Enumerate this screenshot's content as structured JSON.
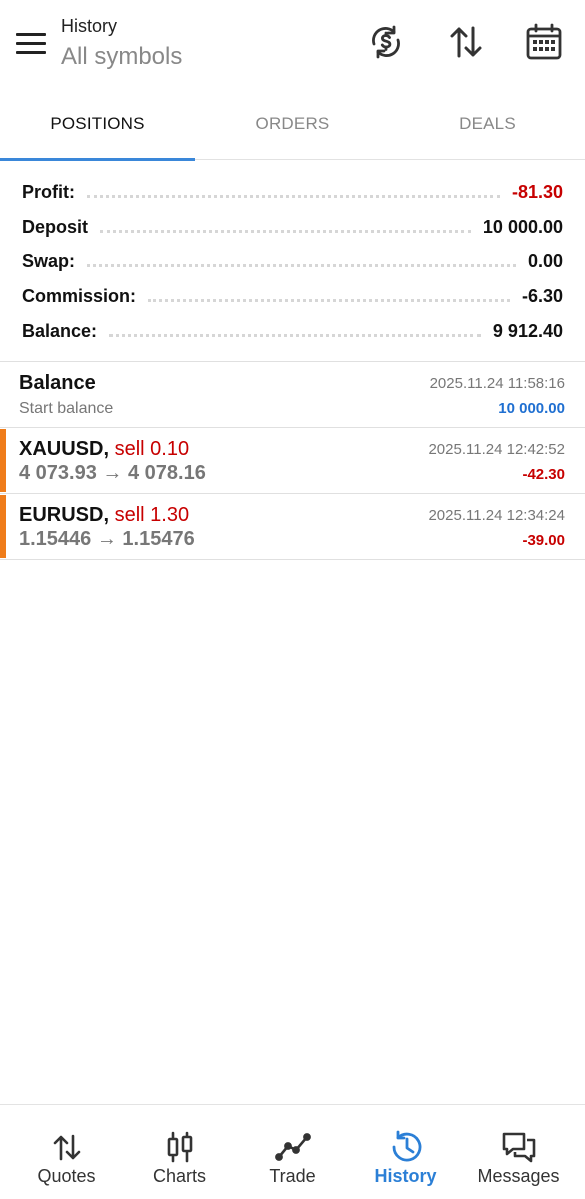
{
  "header": {
    "title": "History",
    "subtitle": "All symbols",
    "icons": [
      "menu-icon",
      "currency-sync-icon",
      "sort-icon",
      "calendar-icon"
    ]
  },
  "tabs": [
    {
      "label": "POSITIONS",
      "active": true
    },
    {
      "label": "ORDERS",
      "active": false
    },
    {
      "label": "DEALS",
      "active": false
    }
  ],
  "summary": [
    {
      "label": "Profit:",
      "value": "-81.30",
      "negative": true
    },
    {
      "label": "Deposit",
      "value": "10 000.00",
      "negative": false
    },
    {
      "label": "Swap:",
      "value": "0.00",
      "negative": false
    },
    {
      "label": "Commission:",
      "value": "-6.30",
      "negative": false
    },
    {
      "label": "Balance:",
      "value": "9 912.40",
      "negative": false
    }
  ],
  "balance_entry": {
    "title": "Balance",
    "subtitle": "Start balance",
    "time": "2025.11.24 11:58:16",
    "amount": "10 000.00"
  },
  "positions": [
    {
      "symbol": "XAUUSD,",
      "side": "sell 0.10",
      "prices": "4 073.93 → 4 078.16",
      "time": "2025.11.24 12:42:52",
      "profit": "-42.30"
    },
    {
      "symbol": "EURUSD,",
      "side": "sell 1.30",
      "prices": "1.15446 → 1.15476",
      "time": "2025.11.24 12:34:24",
      "profit": "-39.00"
    }
  ],
  "colors": {
    "accent": "#2b7fd6",
    "negative": "#c70000",
    "sell_marker": "#ef7c1a"
  },
  "bottom_nav": [
    {
      "label": "Quotes",
      "icon": "quotes-icon",
      "active": false
    },
    {
      "label": "Charts",
      "icon": "candlestick-icon",
      "active": false
    },
    {
      "label": "Trade",
      "icon": "trade-line-icon",
      "active": false
    },
    {
      "label": "History",
      "icon": "history-clock-icon",
      "active": true
    },
    {
      "label": "Messages",
      "icon": "chat-bubbles-icon",
      "active": false
    }
  ]
}
